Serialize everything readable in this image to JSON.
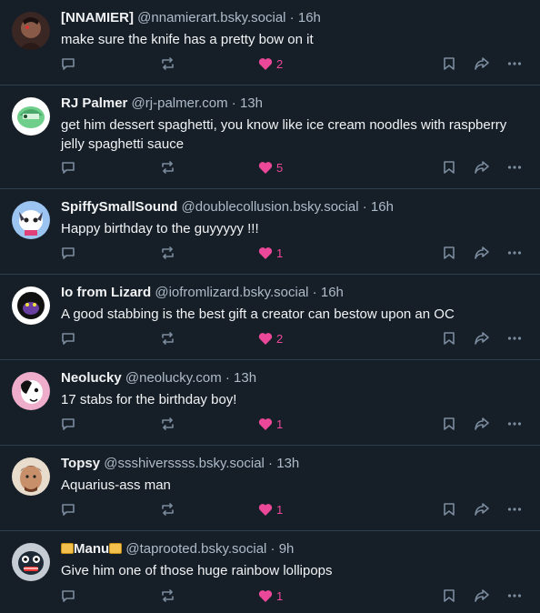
{
  "posts": [
    {
      "name": "[NNAMIER]",
      "handle": "@nnamierart.bsky.social",
      "sep": " · ",
      "time": "16h",
      "text": "make sure the knife has a pretty bow on it",
      "likes": "2",
      "avatar_color": "#5a3a32"
    },
    {
      "name": "RJ Palmer",
      "handle": "@rj-palmer.com",
      "sep": " · ",
      "time": "13h",
      "text": "get him dessert spaghetti, you know like ice cream noodles with raspberry jelly spaghetti sauce",
      "likes": "5",
      "avatar_color": "#7fd07f"
    },
    {
      "name": "SpiffySmallSound",
      "handle": "@doublecollusion.bsky.social",
      "sep": " · ",
      "time": "16h",
      "text": "Happy birthday to the guyyyyy !!!",
      "likes": "1",
      "avatar_color": "#8ab6e8"
    },
    {
      "name": "Io from Lizard",
      "handle": "@iofromlizard.bsky.social",
      "sep": " · ",
      "time": "16h",
      "text": "A good stabbing is the best gift a creator can bestow upon an OC",
      "likes": "2",
      "avatar_color": "#f2f2f2"
    },
    {
      "name": "Neolucky",
      "handle": "@neolucky.com",
      "sep": " · ",
      "time": "13h",
      "text": "17 stabs for the birthday boy!",
      "likes": "1",
      "avatar_color": "#e8a9c4"
    },
    {
      "name": "Topsy",
      "handle": "@ssshiverssss.bsky.social",
      "sep": " · ",
      "time": "13h",
      "text": "Aquarius-ass man",
      "likes": "1",
      "avatar_color": "#c99a7c"
    },
    {
      "name": "Manu",
      "handle": "@taprooted.bsky.social",
      "sep": " · ",
      "time": "9h",
      "text": "Give him one of those huge rainbow lollipops",
      "likes": "1",
      "avatar_color": "#a6b1bb"
    }
  ],
  "colors": {
    "like": "#ec4899",
    "icon": "#7b8c9e",
    "background": "#161e27"
  }
}
